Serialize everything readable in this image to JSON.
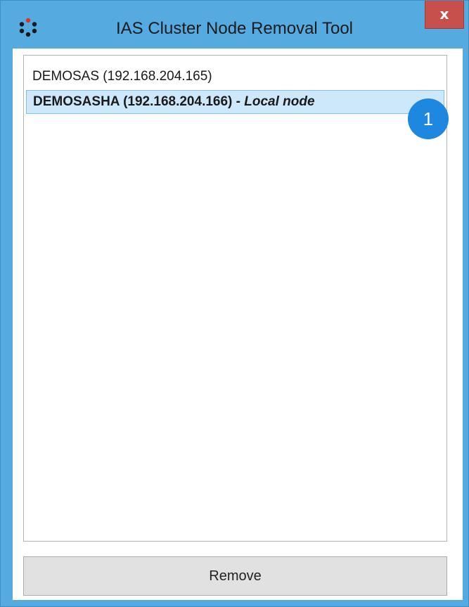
{
  "window": {
    "title": "IAS Cluster Node Removal Tool",
    "close_label": "x"
  },
  "node_list": {
    "items": [
      {
        "name": "DEMOSAS (192.168.204.165)",
        "tag": ""
      },
      {
        "name": "DEMOSASHA (192.168.204.166)",
        "tag": " - Local node",
        "selected": true
      }
    ]
  },
  "annotation": {
    "badge": "1"
  },
  "actions": {
    "remove_label": "Remove"
  },
  "colors": {
    "titlebar": "#55aae0",
    "close_button": "#c7504c",
    "selection": "#cde8fb",
    "badge": "#1e88e0"
  }
}
